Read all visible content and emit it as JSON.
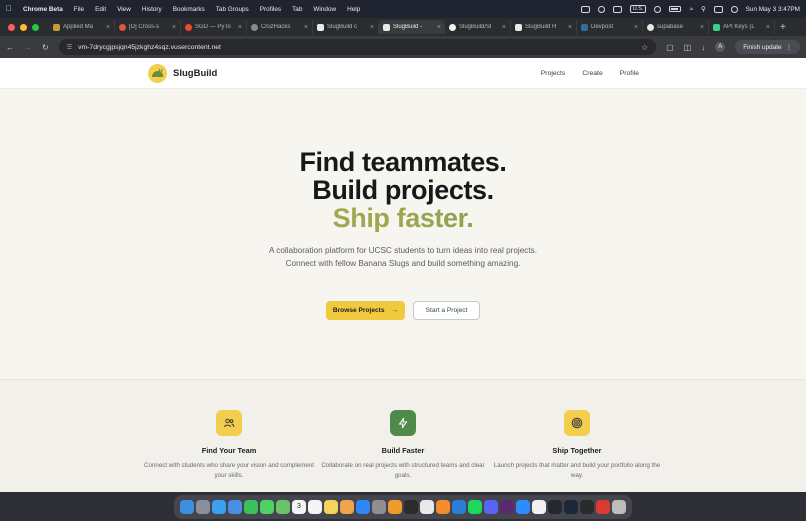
{
  "menubar": {
    "app_name": "Chrome Beta",
    "menus": [
      "File",
      "Edit",
      "View",
      "History",
      "Bookmarks",
      "Tab Groups",
      "Profiles",
      "Tab",
      "Window",
      "Help"
    ],
    "input_source": "U.S.",
    "datetime": "Sun May 3  3:47PM"
  },
  "tabs": [
    {
      "title": "Applied Ma",
      "active": false
    },
    {
      "title": "[D] Cross-s",
      "active": false
    },
    {
      "title": "SGD — PyTo",
      "active": false
    },
    {
      "title": "CruzHacks",
      "active": false
    },
    {
      "title": "SlugBuild c",
      "active": false
    },
    {
      "title": "SlugBuild -",
      "active": true
    },
    {
      "title": "SlugBuild/Sl",
      "active": false
    },
    {
      "title": "SlugBuild H",
      "active": false
    },
    {
      "title": "Devpost",
      "active": false
    },
    {
      "title": "supabase",
      "active": false
    },
    {
      "title": "API Keys (L",
      "active": false
    }
  ],
  "toolbar": {
    "url": "vm-7drycgjpsjqn45jzkghz4sqz.vusercontent.net",
    "profile_initial": "A",
    "update_label": "Finish update"
  },
  "site": {
    "brand": "SlugBuild",
    "nav": [
      "Projects",
      "Create",
      "Profile"
    ]
  },
  "hero": {
    "line1": "Find teammates.",
    "line2": "Build projects.",
    "line3": "Ship faster.",
    "subtitle": "A collaboration platform for UCSC students to turn ideas into real projects. Connect with fellow Banana Slugs and build something amazing.",
    "primary_cta": "Browse Projects",
    "secondary_cta": "Start a Project"
  },
  "features": [
    {
      "title": "Find Your Team",
      "desc": "Connect with students who share your vision and complement your skills.",
      "icon": "users-icon",
      "color": "#f3cd4c"
    },
    {
      "title": "Build Faster",
      "desc": "Collaborate on real projects with structured teams and clear goals.",
      "icon": "zap-icon",
      "color": "#4f8a4a"
    },
    {
      "title": "Ship Together",
      "desc": "Launch projects that matter and build your portfolio along the way.",
      "icon": "target-icon",
      "color": "#f3cd4c"
    }
  ],
  "colors": {
    "accent_yellow": "#f0c93e",
    "accent_green": "#4f8a4a",
    "page_bg": "#f7f5ef"
  },
  "dock": {
    "calendar_day": "3",
    "apps": [
      "finder-icon",
      "launchpad-icon",
      "safari-icon",
      "mail-icon",
      "facetime-icon",
      "messages-icon",
      "maps-icon",
      "calendar-icon",
      "reminders-icon",
      "notes-icon",
      "photos-icon",
      "appstore-icon",
      "settings-icon",
      "pages-icon",
      "terminal-icon",
      "chrome-icon",
      "sublime-icon",
      "vscode-icon",
      "spotify-icon",
      "discord-icon",
      "slack-icon",
      "zoom-icon",
      "notion-icon",
      "github-icon",
      "steam-icon",
      "epic-icon",
      "acrobat-icon",
      "trash-icon"
    ]
  }
}
